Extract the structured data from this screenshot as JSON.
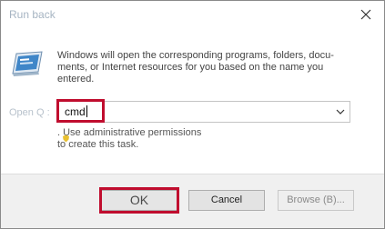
{
  "window": {
    "title": "Run back"
  },
  "dialog": {
    "description": "Windows will open the corresponding programs, folders, docu- ments, or Internet resources for you based on the name you entered.",
    "open_label": "Open Q :",
    "input_value": "cmd",
    "admin_line1": ". Use administrative permissions",
    "admin_line2": "to create this task."
  },
  "buttons": {
    "ok": "OK",
    "cancel": "Cancel",
    "browse": "Browse (B)..."
  },
  "colors": {
    "highlight": "#c00d2e",
    "title_text": "#a6b4c2"
  },
  "icons": {
    "close": "close-icon",
    "run": "run-app-icon",
    "dropdown": "chevron-down-icon",
    "admin": "shield-icon"
  }
}
